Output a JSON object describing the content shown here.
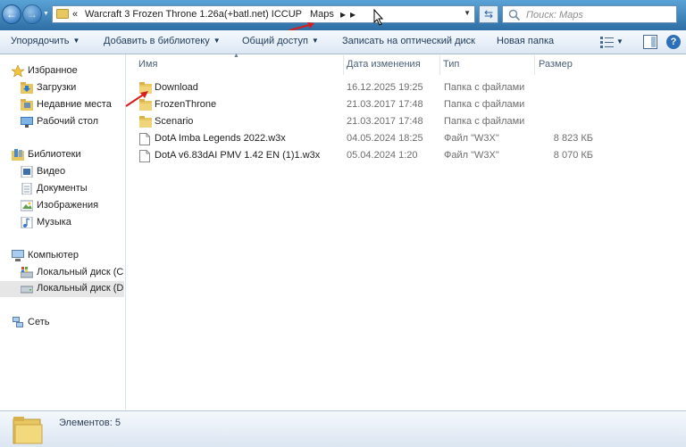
{
  "address": {
    "crumb_prefix": "«",
    "crumbs": [
      "Warcraft 3 Frozen Throne 1.26a(+batl.net) ICCUP",
      "Maps"
    ],
    "search_placeholder": "Поиск: Maps"
  },
  "toolbar": {
    "organize": "Упорядочить",
    "add_to_library": "Добавить в библиотеку",
    "share": "Общий доступ",
    "burn": "Записать на оптический диск",
    "new_folder": "Новая папка"
  },
  "nav": {
    "favorites": "Избранное",
    "downloads": "Загрузки",
    "recent": "Недавние места",
    "desktop": "Рабочий стол",
    "libraries": "Библиотеки",
    "video": "Видео",
    "documents": "Документы",
    "pictures": "Изображения",
    "music": "Музыка",
    "computer": "Компьютер",
    "disk_c": "Локальный диск (C",
    "disk_d": "Локальный диск (D",
    "network": "Сеть"
  },
  "columns": {
    "name": "Имя",
    "date": "Дата изменения",
    "type": "Тип",
    "size": "Размер"
  },
  "files": [
    {
      "name": "Download",
      "date": "16.12.2025 19:25",
      "type": "Папка с файлами",
      "size": "",
      "kind": "folder"
    },
    {
      "name": "FrozenThrone",
      "date": "21.03.2017 17:48",
      "type": "Папка с файлами",
      "size": "",
      "kind": "folder"
    },
    {
      "name": "Scenario",
      "date": "21.03.2017 17:48",
      "type": "Папка с файлами",
      "size": "",
      "kind": "folder"
    },
    {
      "name": "DotA Imba Legends 2022.w3x",
      "date": "04.05.2024 18:25",
      "type": "Файл \"W3X\"",
      "size": "8 823 КБ",
      "kind": "file"
    },
    {
      "name": "DotA v6.83dAI PMV 1.42 EN (1)1.w3x",
      "date": "05.04.2024 1:20",
      "type": "Файл \"W3X\"",
      "size": "8 070 КБ",
      "kind": "file"
    }
  ],
  "status": {
    "items_count": "Элементов: 5"
  },
  "colors": {
    "annotation_arrow": "#d61e1e",
    "address_bar": "#3f84bd",
    "folder": "#e8c660"
  }
}
